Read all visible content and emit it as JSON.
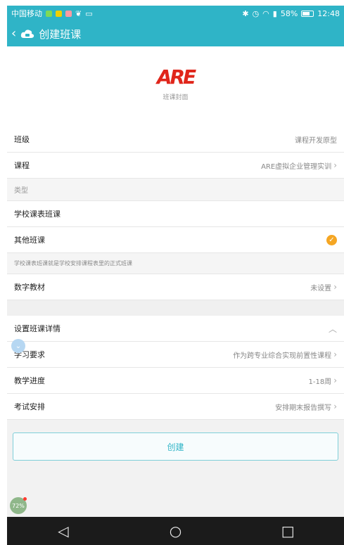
{
  "status_bar": {
    "carrier": "中国移动",
    "battery": "58%",
    "battery_level": 0.58,
    "time": "12:48"
  },
  "header": {
    "title": "创建班课",
    "back_icon": "back-chevron-icon",
    "app_icon": "cloud-class-icon",
    "color": "#2fb4c7"
  },
  "cover": {
    "logo_text": "ARE",
    "label": "班课封面"
  },
  "fields": {
    "class": {
      "label": "班级",
      "value": "课程开发原型"
    },
    "course": {
      "label": "课程",
      "value": "ARE虚拟企业管理实训"
    }
  },
  "type_section": {
    "header": "类型",
    "options": [
      {
        "label": "学校课表班课",
        "selected": false
      },
      {
        "label": "其他班课",
        "selected": true
      }
    ],
    "note": "学校课表班课就是学校安排课程表里的正式班课",
    "check_color": "#f5a623"
  },
  "textbook": {
    "label": "数字教材",
    "value": "未设置"
  },
  "details": {
    "header": "设置班课详情",
    "rows": [
      {
        "label": "学习要求",
        "value": "作为跨专业综合实现前置性课程"
      },
      {
        "label": "教学进度",
        "value": "1-18周"
      },
      {
        "label": "考试安排",
        "value": "安排期末报告撰写"
      }
    ]
  },
  "create_button": "创建",
  "floating_badge": "72%",
  "nav": {
    "back": "◁",
    "home": "○",
    "recents": "□"
  }
}
